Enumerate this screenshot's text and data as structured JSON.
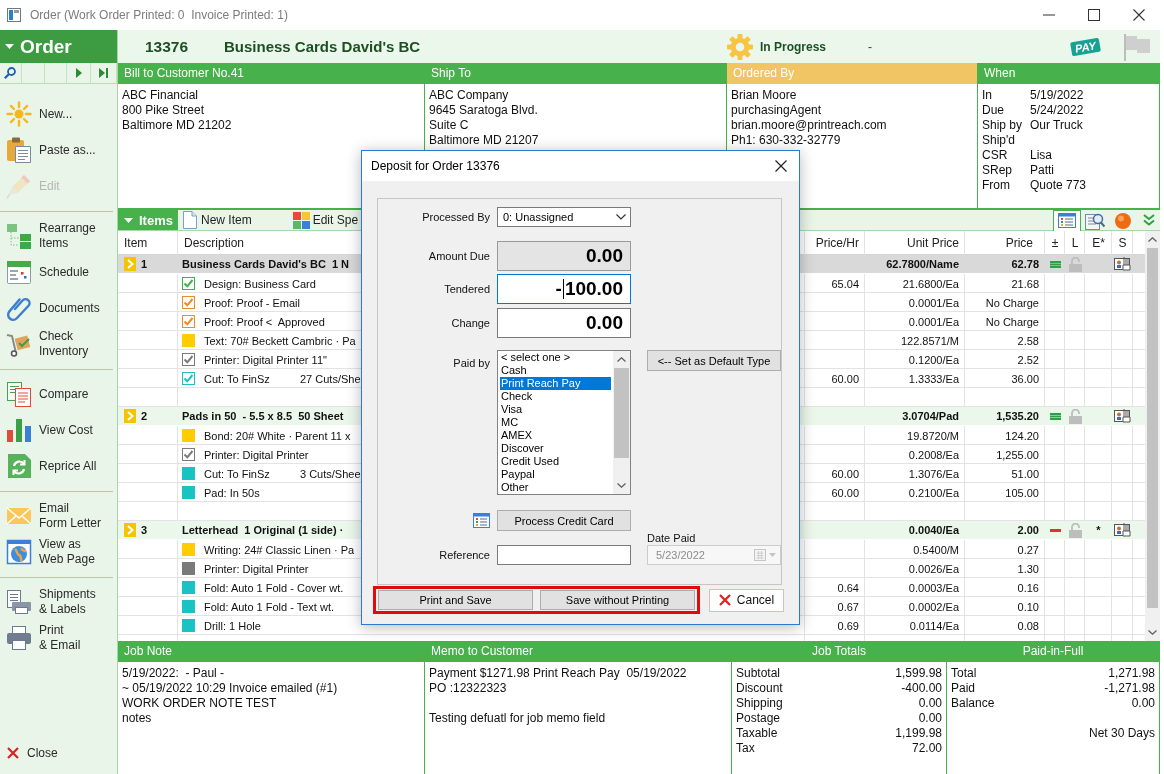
{
  "window": {
    "title": "Order (Work Order Printed: 0  Invoice Printed: 1)"
  },
  "sidebar": {
    "title": "Order",
    "groups": [
      [
        {
          "label": "New...",
          "disabled": false
        },
        {
          "label": "Paste as...",
          "disabled": false
        },
        {
          "label": "Edit",
          "disabled": true
        }
      ],
      [
        {
          "label": "Rearrange\nItems",
          "disabled": false
        },
        {
          "label": "Schedule",
          "disabled": false
        },
        {
          "label": "Documents",
          "disabled": false
        },
        {
          "label": "Check\nInventory",
          "disabled": false
        }
      ],
      [
        {
          "label": "Compare",
          "disabled": false
        },
        {
          "label": "View Cost",
          "disabled": false
        },
        {
          "label": "Reprice All",
          "disabled": false
        }
      ],
      [
        {
          "label": "Email\nForm Letter",
          "disabled": false
        },
        {
          "label": "View as\nWeb Page",
          "disabled": false
        }
      ],
      [
        {
          "label": "Shipments\n& Labels",
          "disabled": false
        },
        {
          "label": "Print\n& Email",
          "disabled": false
        }
      ]
    ],
    "close": "Close"
  },
  "header": {
    "order_number": "13376",
    "job_name": "Business Cards David's BC",
    "status": "In Progress",
    "status_note": "-",
    "pay_logo": "PAY"
  },
  "panels": [
    {
      "title": "Bill to Customer No.41",
      "highlighted": false,
      "lines": [
        "ABC Financial",
        "800 Pike Street",
        "Baltimore MD 21202"
      ]
    },
    {
      "title": "Ship To",
      "highlighted": false,
      "lines": [
        "ABC Company",
        "9645 Saratoga Blvd.",
        "Suite C",
        "Baltimore MD 21207"
      ]
    },
    {
      "title": "Ordered By",
      "highlighted": true,
      "lines": [
        "Brian Moore",
        "purchasingAgent",
        "brian.moore@printreach.com",
        "Ph1: 630-332-32779"
      ]
    }
  ],
  "when": {
    "title": "When",
    "rows": [
      {
        "label": "In",
        "value": "5/19/2022"
      },
      {
        "label": "Due",
        "value": "5/24/2022"
      },
      {
        "label": "Ship by",
        "value": "Our Truck"
      },
      {
        "label": "Ship'd"
      },
      {
        "label": "CSR",
        "value": "Lisa"
      },
      {
        "label": "SRep",
        "value": "Patti"
      },
      {
        "label": "From",
        "value": "Quote 773"
      }
    ]
  },
  "items_toolbar": {
    "tab": "Items",
    "actions": [
      "New Item",
      "Edit Spe"
    ],
    "views": [
      {
        "selected": true
      },
      {
        "selected": false
      },
      {
        "selected": false
      }
    ]
  },
  "table": {
    "columns": [
      "Item",
      "Description",
      "Price/Hr",
      "Unit Price",
      "Price",
      "±",
      "L",
      "E*",
      "S"
    ],
    "groups": [
      {
        "number": "1",
        "description": "Business Cards David's BC  1 N",
        "unit_price": "62.7800/Name",
        "price": "62.78",
        "adjust": {
          "kind": "equal"
        },
        "selected": true,
        "lines": [
          {
            "kind": "check",
            "color": "#3bb54a",
            "description": "Design: Business Card",
            "price_hr": "65.04",
            "unit_price": "21.6800/Ea",
            "price": "21.68"
          },
          {
            "kind": "check",
            "color": "#f08a24",
            "description": "Proof: Proof - Email",
            "unit_price": "0.0001/Ea",
            "price": "No Charge"
          },
          {
            "kind": "check",
            "color": "#f08a24",
            "description": "Proof: Proof <  Approved",
            "unit_price": "0.0001/Ea",
            "price": "No Charge"
          },
          {
            "kind": "square",
            "color": "#ffcc00",
            "description": "Text: 70# Beckett Cambric · Pa",
            "unit_price": "122.8571/M",
            "price": "2.58"
          },
          {
            "kind": "check",
            "color": "#7a7a7a",
            "description": "Printer: Digital Printer 11\"",
            "unit_price": "0.1200/Ea",
            "price": "2.52"
          },
          {
            "kind": "check",
            "color": "#19c3c3",
            "description": "Cut: To FinSz",
            "detail": "27 Cuts/She",
            "price_hr": "60.00",
            "unit_price": "1.3333/Ea",
            "price": "36.00"
          }
        ]
      },
      {
        "number": "2",
        "description": "Pads in 50  - 5.5 x 8.5  50 Sheet",
        "unit_price": "3.0704/Pad",
        "price": "1,535.20",
        "adjust": {
          "kind": "equal"
        },
        "selected": false,
        "lines": [
          {
            "kind": "square",
            "color": "#ffcc00",
            "description": "Bond: 20# White · Parent 11 x",
            "unit_price": "19.8720/M",
            "price": "124.20"
          },
          {
            "kind": "check",
            "color": "#7a7a7a",
            "description": "Printer: Digital Printer",
            "unit_price": "0.2008/Ea",
            "price": "1,255.00"
          },
          {
            "kind": "square",
            "color": "#19c3c3",
            "description": "Cut: To FinSz",
            "detail": "3 Cuts/Shee",
            "price_hr": "60.00",
            "unit_price": "1.3076/Ea",
            "price": "51.00"
          },
          {
            "kind": "square",
            "color": "#19c3c3",
            "description": "Pad: In 50s",
            "price_hr": "60.00",
            "unit_price": "0.2100/Ea",
            "price": "105.00"
          }
        ]
      },
      {
        "number": "3",
        "description": "Letterhead  1 Original (1 side) ·",
        "unit_price": "0.0040/Ea",
        "price": "2.00",
        "adjust": {
          "kind": "minus"
        },
        "e_star": "*",
        "selected": false,
        "lines": [
          {
            "kind": "square",
            "color": "#ffcc00",
            "description": "Writing: 24# Classic Linen · Pa",
            "unit_price": "0.5400/M",
            "price": "0.27"
          },
          {
            "kind": "square",
            "color": "#7a7a7a",
            "description": "Printer: Digital Printer",
            "unit_price": "0.0026/Ea",
            "price": "1.30"
          },
          {
            "kind": "square",
            "color": "#19c3c3",
            "description": "Fold: Auto 1 Fold - Cover wt.",
            "price_hr": "0.64",
            "unit_price": "0.0003/Ea",
            "price": "0.16"
          },
          {
            "kind": "square",
            "color": "#19c3c3",
            "description": "Fold: Auto 1 Fold - Text wt.",
            "price_hr": "0.67",
            "unit_price": "0.0002/Ea",
            "price": "0.10"
          },
          {
            "kind": "square",
            "color": "#19c3c3",
            "description": "Drill: 1 Hole",
            "price_hr": "0.69",
            "unit_price": "0.0114/Ea",
            "price": "0.08"
          }
        ]
      }
    ]
  },
  "footer": {
    "job_note": {
      "title": "Job Note",
      "lines": [
        "5/19/2022:  - Paul -",
        "~ 05/19/2022 10:29 Invoice emailed (#1)",
        "WORK ORDER NOTE TEST",
        "notes"
      ]
    },
    "memo": {
      "title": "Memo to Customer",
      "paragraphs": [
        [
          "Payment $1271.98 Print Reach Pay  05/19/2022",
          "PO :12322323"
        ],
        [
          "Testing defuatl for job memo field"
        ]
      ]
    },
    "job_totals": {
      "title": "Job Totals",
      "rows": [
        {
          "label": "Subtotal",
          "value": "1,599.98"
        },
        {
          "label": "Discount",
          "value": "-400.00"
        },
        {
          "label": "Shipping",
          "value": "0.00"
        },
        {
          "label": "Postage",
          "value": "0.00"
        },
        {
          "label": "Taxable",
          "value": "1,199.98"
        },
        {
          "label": "Tax",
          "value": "72.00"
        }
      ]
    },
    "paid_in_full": {
      "title": "Paid-in-Full",
      "rows": [
        {
          "label": "Total",
          "value": "1,271.98"
        },
        {
          "label": "Paid",
          "value": "-1,271.98"
        },
        {
          "label": "Balance",
          "value": "0.00"
        }
      ],
      "terms": "Net 30 Days"
    }
  },
  "dialog": {
    "title": "Deposit for Order 13376",
    "processed_by": {
      "label": "Processed By",
      "value": "0: Unassigned"
    },
    "amounts": [
      {
        "label": "Amount Due",
        "value": "0.00",
        "readonly": true,
        "focused": false
      },
      {
        "label": "Tendered",
        "value": "-100.00",
        "readonly": false,
        "focused": true
      },
      {
        "label": "Change",
        "value": "0.00",
        "readonly": false,
        "focused": false
      }
    ],
    "paid_by": {
      "label": "Paid by",
      "options": [
        {
          "label": "< select one >",
          "selected": false
        },
        {
          "label": "Cash",
          "selected": false
        },
        {
          "label": "Print Reach Pay",
          "selected": true
        },
        {
          "label": "Check",
          "selected": false
        },
        {
          "label": "Visa",
          "selected": false
        },
        {
          "label": "MC",
          "selected": false
        },
        {
          "label": "AMEX",
          "selected": false
        },
        {
          "label": "Discover",
          "selected": false
        },
        {
          "label": "Credit Used",
          "selected": false
        },
        {
          "label": "Paypal",
          "selected": false
        },
        {
          "label": "Other",
          "selected": false
        }
      ]
    },
    "default_type_button": "<-- Set as Default Type",
    "process_card_button": "Process Credit Card",
    "reference": {
      "label": "Reference"
    },
    "date_paid": {
      "label": "Date Paid",
      "value": "5/23/2022",
      "disabled": true
    },
    "actions": {
      "highlighted": true,
      "buttons": [
        "Print and Save",
        "Save without Printing"
      ]
    },
    "cancel": "Cancel"
  }
}
